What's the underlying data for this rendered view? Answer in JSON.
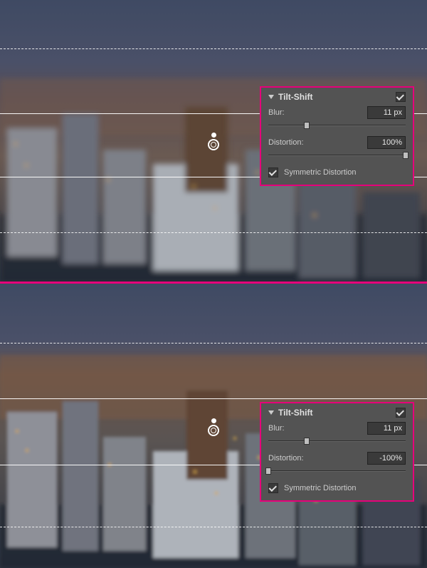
{
  "panels": [
    {
      "title": "Tilt-Shift",
      "enabled": true,
      "blur": {
        "label": "Blur:",
        "value": "11 px",
        "pos": 28
      },
      "distortion": {
        "label": "Distortion:",
        "value": "100%",
        "pos": 100
      },
      "symmetric": {
        "label": "Symmetric Distortion",
        "checked": true
      }
    },
    {
      "title": "Tilt-Shift",
      "enabled": true,
      "blur": {
        "label": "Blur:",
        "value": "11 px",
        "pos": 28
      },
      "distortion": {
        "label": "Distortion:",
        "value": "-100%",
        "pos": 0
      },
      "symmetric": {
        "label": "Symmetric Distortion",
        "checked": true
      }
    }
  ],
  "guides": {
    "top": {
      "dash1": 68,
      "solid1": 159,
      "pin": 197,
      "solid2": 248,
      "dash2": 326
    },
    "bot": {
      "dash1": 83,
      "solid1": 161,
      "pin": 200,
      "solid2": 254,
      "dash2": 341
    }
  }
}
